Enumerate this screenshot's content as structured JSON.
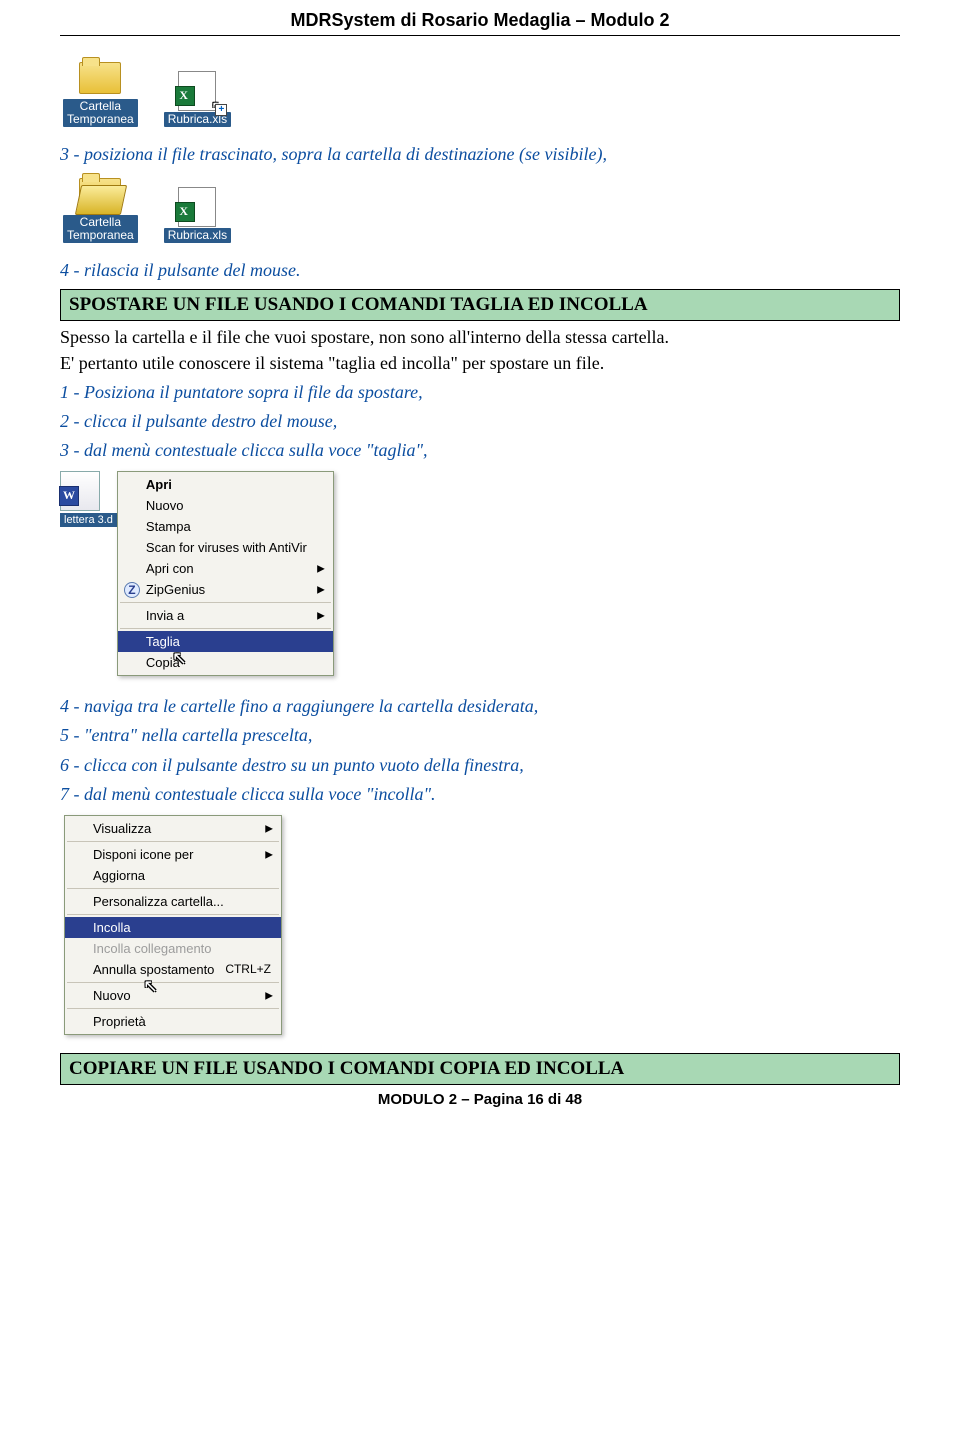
{
  "header": "MDRSystem di Rosario Medaglia – Modulo 2",
  "snip1": {
    "folder_label": "Cartella\nTemporanea",
    "file_label": "Rubrica.xls"
  },
  "step3": "3 - posiziona il file trascinato, sopra la cartella di destinazione (se visibile),",
  "snip2": {
    "folder_label": "Cartella\nTemporanea",
    "file_label": "Rubrica.xls"
  },
  "step4": "4 - rilascia il pulsante del mouse.",
  "banner1": "SPOSTARE UN FILE USANDO I COMANDI TAGLIA ED INCOLLA",
  "para1": "Spesso la cartella e il file che vuoi spostare, non sono all'interno della stessa cartella.",
  "para2": "E' pertanto utile conoscere il sistema \"taglia ed incolla\" per spostare un file.",
  "step_b1": "1 - Posiziona il puntatore sopra il file da spostare,",
  "step_b2": "2 - clicca il pulsante destro del mouse,",
  "step_b3": "3 - dal menù contestuale clicca sulla voce \"taglia\",",
  "file_thumb_label": "lettera 3.d",
  "menu1": {
    "apri": "Apri",
    "nuovo": "Nuovo",
    "stampa": "Stampa",
    "scan": "Scan for viruses with AntiVir",
    "apri_con": "Apri con",
    "zip": "ZipGenius",
    "invia": "Invia a",
    "taglia": "Taglia",
    "copia": "Copia"
  },
  "step_c4": "4 - naviga tra le cartelle fino a raggiungere la cartella desiderata,",
  "step_c5": "5 - \"entra\" nella cartella prescelta,",
  "step_c6": "6 - clicca con il pulsante destro su un punto vuoto della finestra,",
  "step_c7": "7 - dal menù contestuale clicca sulla voce \"incolla\".",
  "menu2": {
    "visualizza": "Visualizza",
    "disponi": "Disponi icone per",
    "aggiorna": "Aggiorna",
    "personalizza": "Personalizza cartella...",
    "incolla": "Incolla",
    "incolla_coll": "Incolla collegamento",
    "annulla": "Annulla spostamento",
    "annulla_sc": "CTRL+Z",
    "nuovo": "Nuovo",
    "proprieta": "Proprietà"
  },
  "banner2": "COPIARE UN FILE USANDO I COMANDI COPIA ED INCOLLA",
  "footer": "MODULO 2 – Pagina 16 di 48"
}
